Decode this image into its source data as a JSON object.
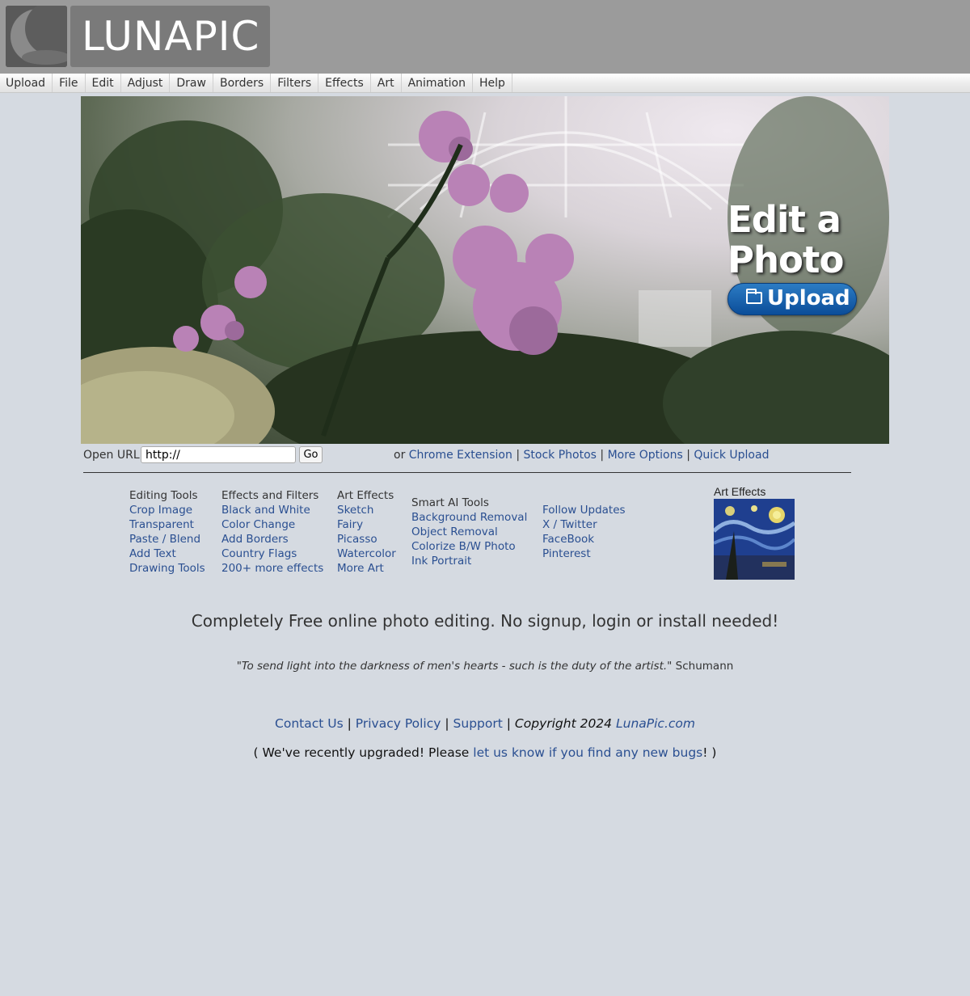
{
  "logo": {
    "text": "LUNAPIC"
  },
  "menu": [
    "Upload",
    "File",
    "Edit",
    "Adjust",
    "Draw",
    "Borders",
    "Filters",
    "Effects",
    "Art",
    "Animation",
    "Help"
  ],
  "hero": {
    "title": "Edit a\nPhoto",
    "upload_label": "Upload",
    "icon": "folder-icon"
  },
  "url_bar": {
    "label": "Open URL:",
    "value": "http://",
    "go_label": "Go"
  },
  "url_links": {
    "prefix": "or",
    "items": [
      "Chrome Extension",
      "Stock Photos",
      "More Options",
      "Quick Upload"
    ],
    "separator": "|"
  },
  "columns": {
    "editing": {
      "title": "Editing Tools",
      "items": [
        "Crop Image",
        "Transparent",
        "Paste / Blend",
        "Add Text",
        "Drawing Tools"
      ]
    },
    "effects": {
      "title": "Effects and Filters",
      "items": [
        "Black and White",
        "Color Change",
        "Add Borders",
        "Country Flags",
        "200+ more effects"
      ]
    },
    "art": {
      "title": "Art Effects",
      "items": [
        "Sketch",
        "Fairy",
        "Picasso",
        "Watercolor",
        "More Art"
      ]
    },
    "ai": {
      "title": "Smart AI Tools",
      "items": [
        "Background Removal",
        "Object Removal",
        "Colorize B/W Photo",
        "Ink Portrait"
      ]
    },
    "follow": {
      "items": [
        "Follow Updates",
        "X / Twitter",
        "FaceBook",
        "Pinterest"
      ]
    }
  },
  "art_box": {
    "title": "Art Effects"
  },
  "tagline": "Completely Free online photo editing. No signup, login or install needed!",
  "quote": {
    "text": "\"To send light into the darkness of men's hearts - such is the duty of the artist.\"",
    "author": "Schumann"
  },
  "footer": {
    "contact": "Contact Us",
    "privacy": "Privacy Policy",
    "support": "Support",
    "copyright": "Copyright 2024",
    "site": "LunaPic.com",
    "sep": "|"
  },
  "notice": {
    "before": "( We've recently upgraded! Please",
    "link": "let us know if you find any new bugs",
    "after": "! )"
  },
  "colors": {
    "link": "#2a4f91",
    "background": "#d5dae1",
    "header": "#9b9b9b",
    "upload_button": "#0b4d99"
  }
}
